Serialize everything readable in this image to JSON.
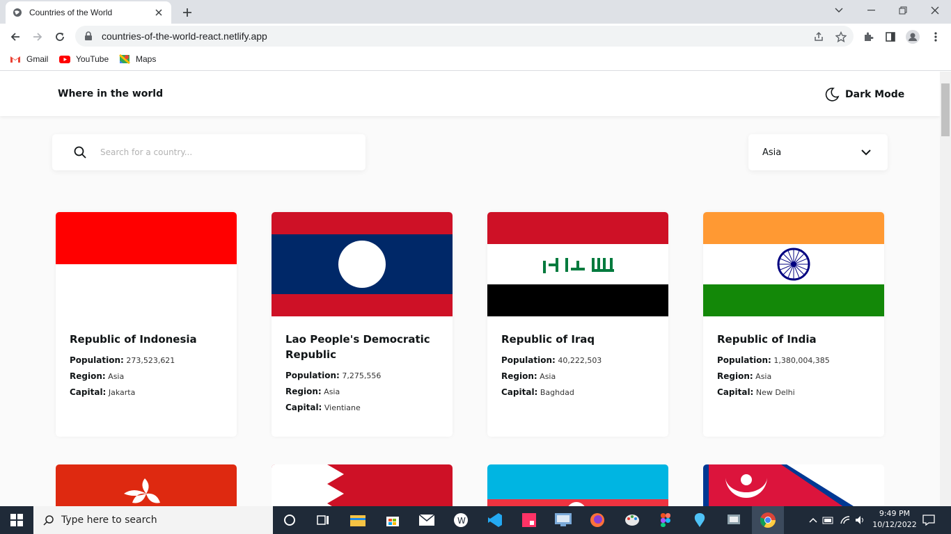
{
  "browser": {
    "tab_title": "Countries of the World",
    "url": "countries-of-the-world-react.netlify.app",
    "bookmarks": [
      {
        "label": "Gmail",
        "icon": "gmail-icon"
      },
      {
        "label": "YouTube",
        "icon": "youtube-icon"
      },
      {
        "label": "Maps",
        "icon": "maps-icon"
      }
    ]
  },
  "app": {
    "title": "Where in the world",
    "dark_mode_label": "Dark Mode",
    "search_placeholder": "Search for a country...",
    "region_filter": "Asia",
    "field_labels": {
      "population": "Population:",
      "region": "Region:",
      "capital": "Capital:"
    },
    "countries": [
      {
        "name": "Republic of Indonesia",
        "population": "273,523,621",
        "region": "Asia",
        "capital": "Jakarta",
        "flag": "indonesia-flag"
      },
      {
        "name": "Lao People's Democratic Republic",
        "population": "7,275,556",
        "region": "Asia",
        "capital": "Vientiane",
        "flag": "laos-flag"
      },
      {
        "name": "Republic of Iraq",
        "population": "40,222,503",
        "region": "Asia",
        "capital": "Baghdad",
        "flag": "iraq-flag"
      },
      {
        "name": "Republic of India",
        "population": "1,380,004,385",
        "region": "Asia",
        "capital": "New Delhi",
        "flag": "india-flag"
      }
    ],
    "next_row_flags": [
      "hong-kong-flag",
      "bahrain-flag",
      "azerbaijan-flag",
      "nepal-flag"
    ]
  },
  "taskbar": {
    "search_placeholder": "Type here to search",
    "time": "9:49 PM",
    "date": "10/12/2022"
  },
  "colors": {
    "page_bg": "#fafafa",
    "card_bg": "#ffffff",
    "text": "#111517",
    "taskbar_bg": "#1f2a38"
  }
}
